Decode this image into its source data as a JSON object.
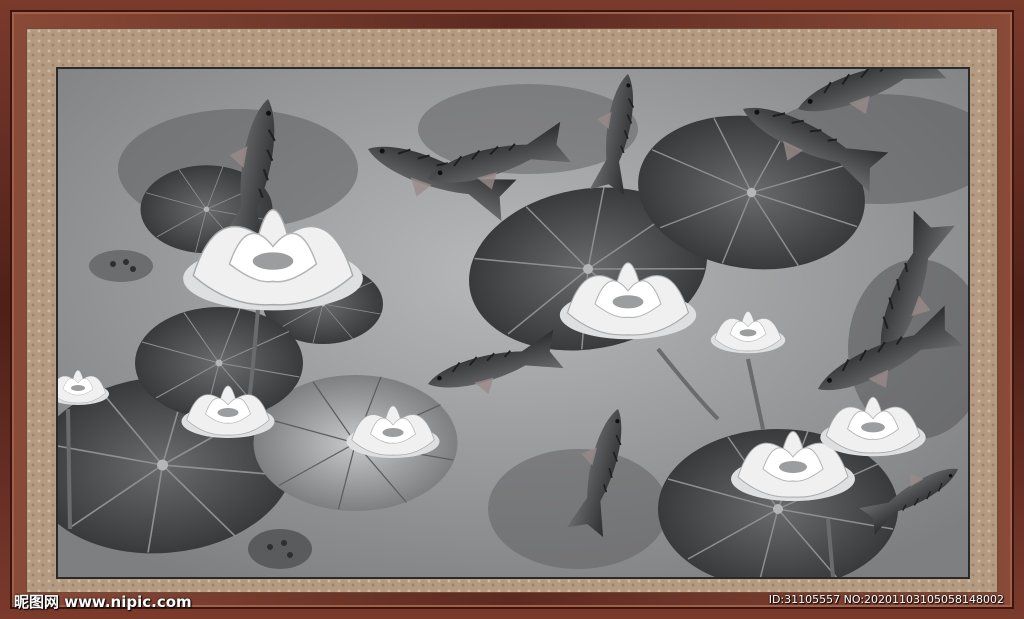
{
  "watermark": {
    "site": "昵图网 www.nipic.com",
    "id_text": "ID:31105557 NO:20201103105058148002"
  },
  "colors": {
    "frame": "#5a2a22",
    "mat": "#b59a82",
    "ink_dark": "#3a3b3d",
    "ink_mid": "#7d7e80",
    "petal": "#e9e9e9",
    "background": "#9a9b9c"
  },
  "painting": {
    "subject_icons": [
      "koi-fish-icon",
      "lotus-flower-icon",
      "lotus-leaf-icon",
      "lotus-seedpod-icon"
    ]
  }
}
